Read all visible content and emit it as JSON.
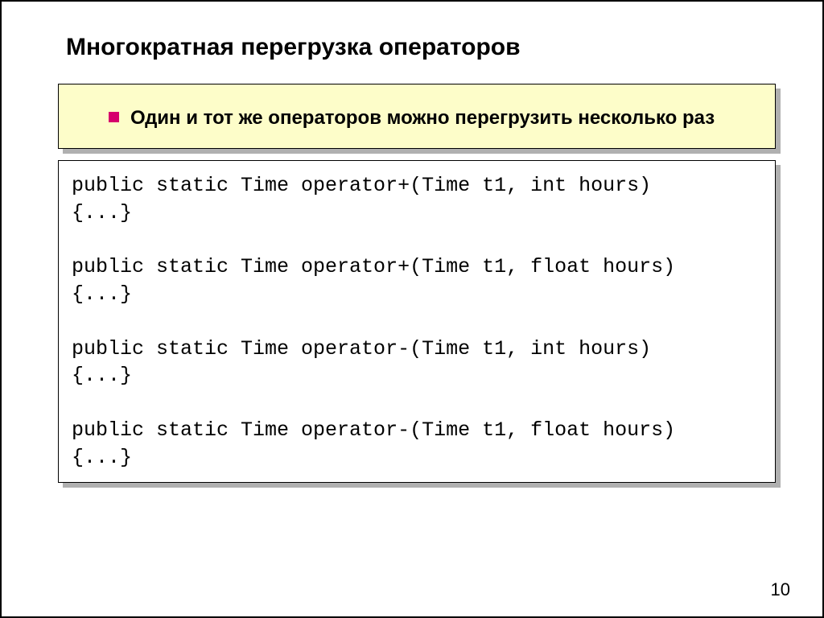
{
  "slide": {
    "title": "Многократная перегрузка операторов",
    "bullet_text": "Один и тот же операторов можно перегрузить несколько раз",
    "code": "public static Time operator+(Time t1, int hours)\n{...}\n\npublic static Time operator+(Time t1, float hours)\n{...}\n\npublic static Time operator-(Time t1, int hours)\n{...}\n\npublic static Time operator-(Time t1, float hours)\n{...}",
    "page_number": "10"
  }
}
